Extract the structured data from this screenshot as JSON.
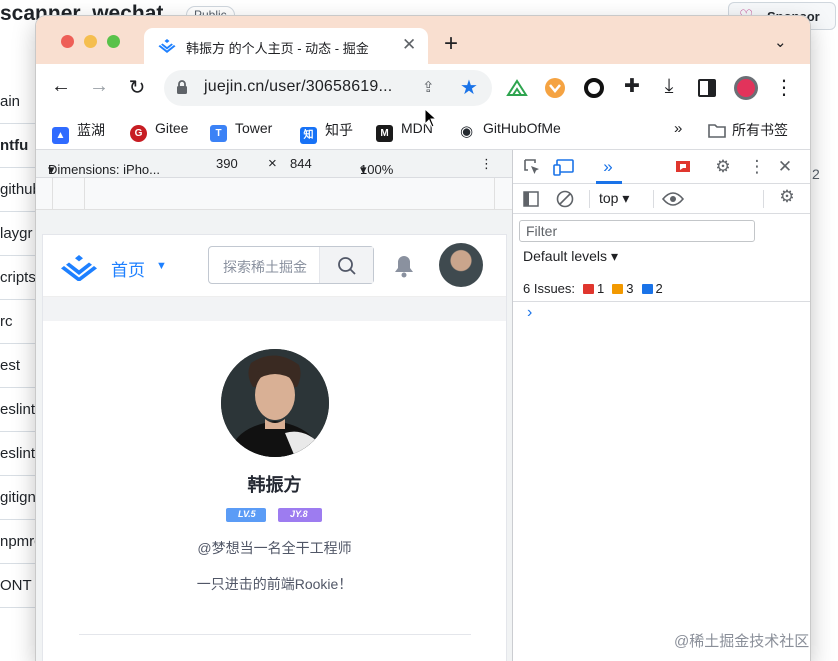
{
  "background": {
    "repo_title": "scanner_wechat",
    "visibility": "Public",
    "sponsor": "Sponsor",
    "files": [
      "ain",
      "ntfu",
      "github",
      "laygr",
      "cripts",
      "rc",
      "est",
      "eslint",
      "eslintr",
      "gitign",
      "npmrc",
      "ONT"
    ],
    "right_number": "2"
  },
  "tab": {
    "title": "韩振方 的个人主页 - 动态 - 掘金",
    "close": "✕"
  },
  "newtab": "+",
  "tabmenu": "⌄",
  "toolbar": {
    "back": "←",
    "forward": "→",
    "reload": "↻",
    "url": "juejin.cn/user/30658619...",
    "menu": "⋮"
  },
  "bookmarks": [
    {
      "label": "蓝湖",
      "color": "#2f6bff",
      "glyph": "蓝"
    },
    {
      "label": "Gitee",
      "color": "#c71d23",
      "glyph": "G"
    },
    {
      "label": "Tower",
      "color": "#3b82f6",
      "glyph": "T"
    },
    {
      "label": "知乎",
      "color": "#1772f6",
      "glyph": "知"
    },
    {
      "label": "MDN",
      "color": "#1b1b1b",
      "glyph": "M"
    },
    {
      "label": "GitHubOfMe",
      "color": "#24292f",
      "glyph": "◯"
    }
  ],
  "bookmarks_more": "»",
  "bookmarks_folder": "所有书签",
  "device_bar": {
    "device": "Dimensions: iPho...",
    "width": "390",
    "times": "×",
    "height": "844",
    "zoom": "100%",
    "caret": "▾",
    "more": "⋮"
  },
  "juejin": {
    "home": "首页",
    "search_placeholder": "探索稀土掘金",
    "user_name": "韩振方",
    "badge_lv": "LV.5",
    "badge_jy": "JY.8",
    "handle": "@梦想当一名全干工程师",
    "bio": "一只进击的前端Rookie！"
  },
  "devtools": {
    "context": "top",
    "filter_placeholder": "Filter",
    "levels": "Default levels",
    "issues_label": "6 Issues:",
    "issues_error": "1",
    "issues_warning": "3",
    "issues_info": "2",
    "prompt": "›",
    "close": "✕",
    "more": "⋮",
    "tabs_more": "»"
  },
  "colors": {
    "accent": "#1e80ff",
    "tab_bar": "#f9dfd0",
    "error": "#e0362e",
    "warning": "#f29900",
    "info": "#1a73e8"
  },
  "watermark": "@稀土掘金技术社区"
}
